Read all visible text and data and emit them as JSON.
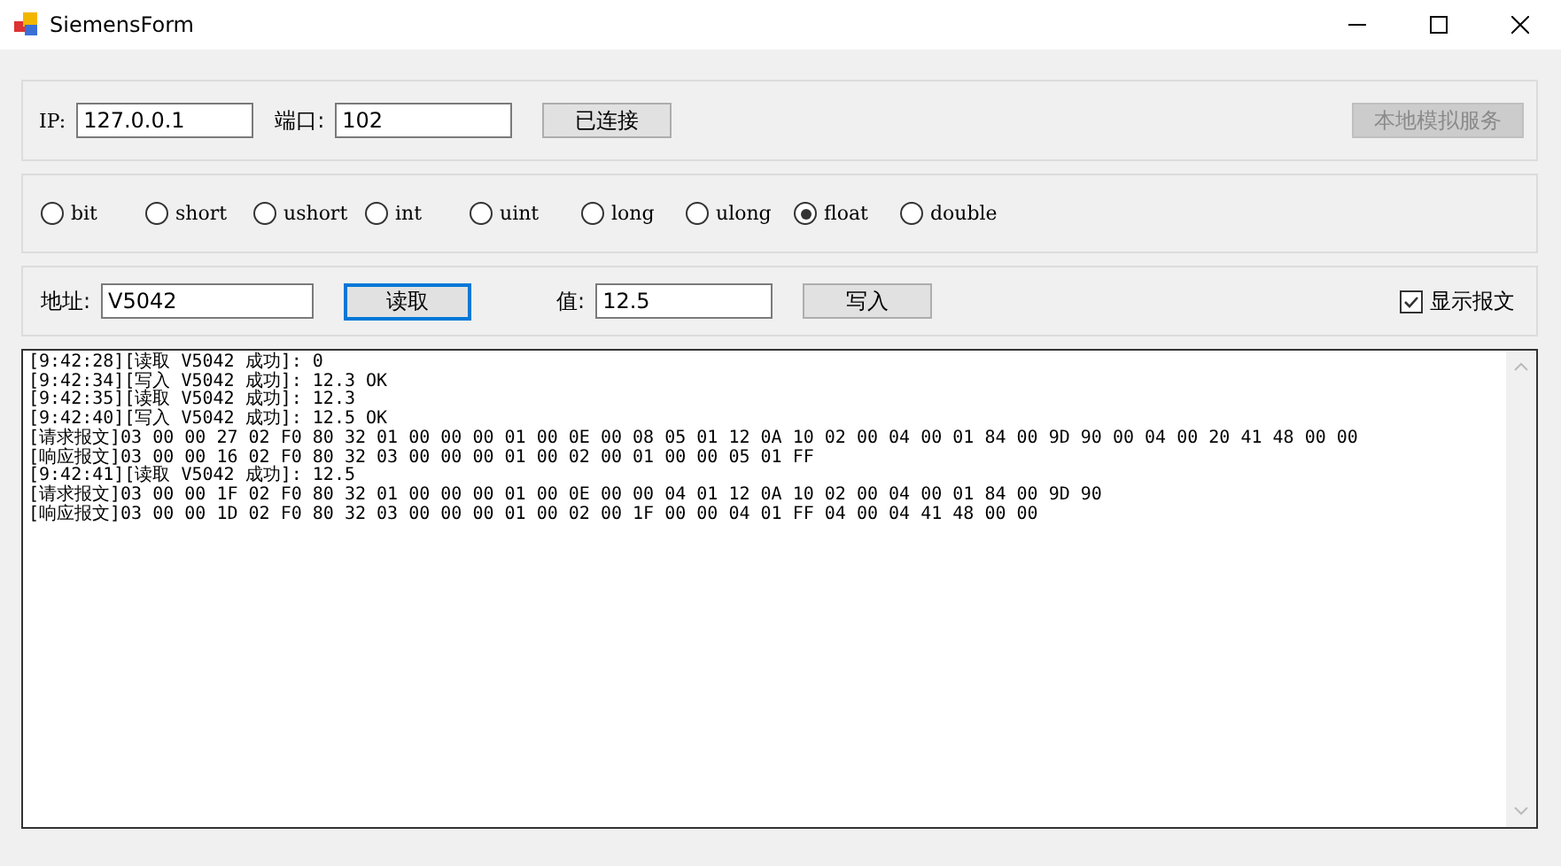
{
  "window": {
    "title": "SiemensForm"
  },
  "connection": {
    "ip_label": "IP:",
    "ip": "127.0.0.1",
    "port_label": "端口:",
    "port": "102",
    "connect_button": "已连接",
    "server_button": {
      "label": "本地模拟服务",
      "disabled": true
    }
  },
  "types": [
    {
      "label": "bit",
      "selected": false
    },
    {
      "label": "short",
      "selected": false
    },
    {
      "label": "ushort",
      "selected": false
    },
    {
      "label": "int",
      "selected": false
    },
    {
      "label": "uint",
      "selected": false
    },
    {
      "label": "long",
      "selected": false
    },
    {
      "label": "ulong",
      "selected": false
    },
    {
      "label": "float",
      "selected": true
    },
    {
      "label": "double",
      "selected": false
    }
  ],
  "access": {
    "address_label": "地址:",
    "address": "V5042",
    "read_button": "读取",
    "value_label": "值:",
    "value": "12.5",
    "write_button": "写入",
    "show_packets": {
      "label": "显示报文",
      "checked": true
    }
  },
  "log": [
    "[9:42:28][读取 V5042 成功]: 0",
    "[9:42:34][写入 V5042 成功]: 12.3 OK",
    "[9:42:35][读取 V5042 成功]: 12.3",
    "[9:42:40][写入 V5042 成功]: 12.5 OK",
    "[请求报文]03 00 00 27 02 F0 80 32 01 00 00 00 01 00 0E 00 08 05 01 12 0A 10 02 00 04 00 01 84 00 9D 90 00 04 00 20 41 48 00 00",
    "[响应报文]03 00 00 16 02 F0 80 32 03 00 00 00 01 00 02 00 01 00 00 05 01 FF",
    "[9:42:41][读取 V5042 成功]: 12.5",
    "[请求报文]03 00 00 1F 02 F0 80 32 01 00 00 00 01 00 0E 00 00 04 01 12 0A 10 02 00 04 00 01 84 00 9D 90",
    "[响应报文]03 00 00 1D 02 F0 80 32 03 00 00 00 01 00 02 00 1F 00 00 04 01 FF 04 00 04 41 48 00 00"
  ]
}
